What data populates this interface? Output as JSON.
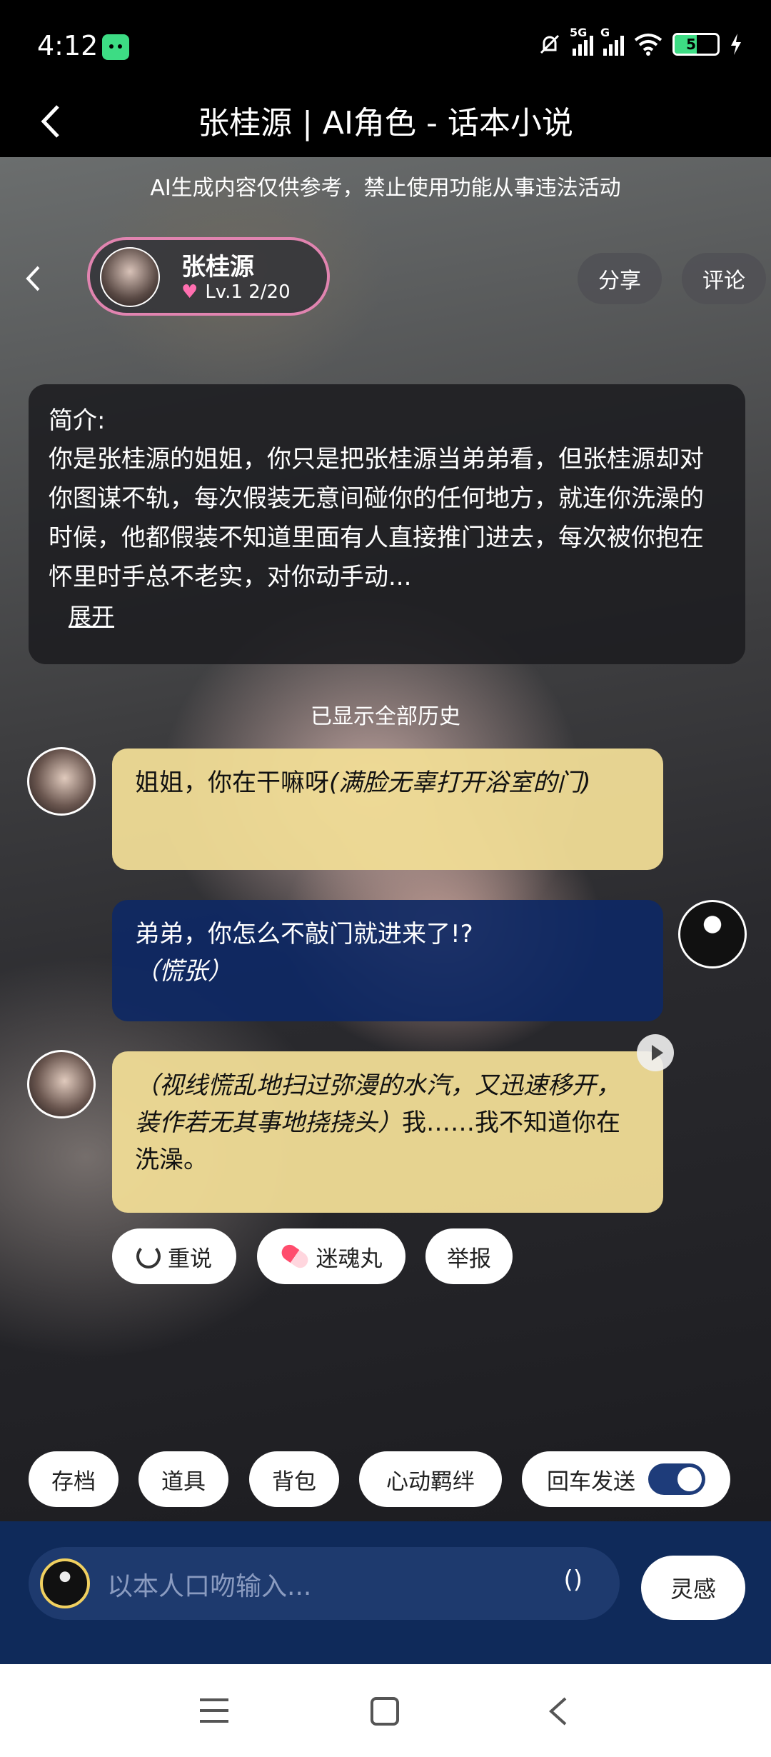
{
  "status_bar": {
    "time": "4:12",
    "network_1": "5G",
    "network_2": "G",
    "battery": "52"
  },
  "header": {
    "title": "张桂源 | AI角色 - 话本小说"
  },
  "disclaimer": "AI生成内容仅供参考，禁止使用功能从事违法活动",
  "profile": {
    "name": "张桂源",
    "level": "Lv.1  2/20"
  },
  "top_actions": {
    "share": "分享",
    "comment": "评论"
  },
  "intro": {
    "label": "简介:",
    "text": "你是张桂源的姐姐，你只是把张桂源当弟弟看，但张桂源却对你图谋不轨，每次假装无意间碰你的任何地方，就连你洗澡的时候，他都假装不知道里面有人直接推门进去，每次被你抱在怀里时手总不老实，对你动手动...",
    "expand": "展开"
  },
  "history_note": "已显示全部历史",
  "messages": [
    {
      "from": "character",
      "text": "姐姐，你在干嘛呀",
      "narration": "(满脸无辜打开浴室的门)"
    },
    {
      "from": "user",
      "text": "弟弟，你怎么不敲门就进来了!?",
      "narration": "（慌张）"
    },
    {
      "from": "character",
      "narration": "（视线慌乱地扫过弥漫的水汽，又迅速移开，装作若无其事地挠挠头）",
      "text": "我……我不知道你在洗澡。"
    }
  ],
  "message_actions": {
    "retry": "重说",
    "potion": "迷魂丸",
    "report": "举报"
  },
  "toolbar": {
    "save": "存档",
    "props": "道具",
    "bag": "背包",
    "bond": "心动羁绊",
    "enter_send": "回车发送",
    "enter_send_on": true
  },
  "input": {
    "placeholder": "以本人口吻输入...",
    "paren": "()",
    "inspire": "灵感"
  },
  "colors": {
    "character_bubble": "#f0dc96",
    "user_bubble": "#0e2864",
    "input_bar": "#0f2a5a",
    "profile_border": "#e184b0"
  }
}
